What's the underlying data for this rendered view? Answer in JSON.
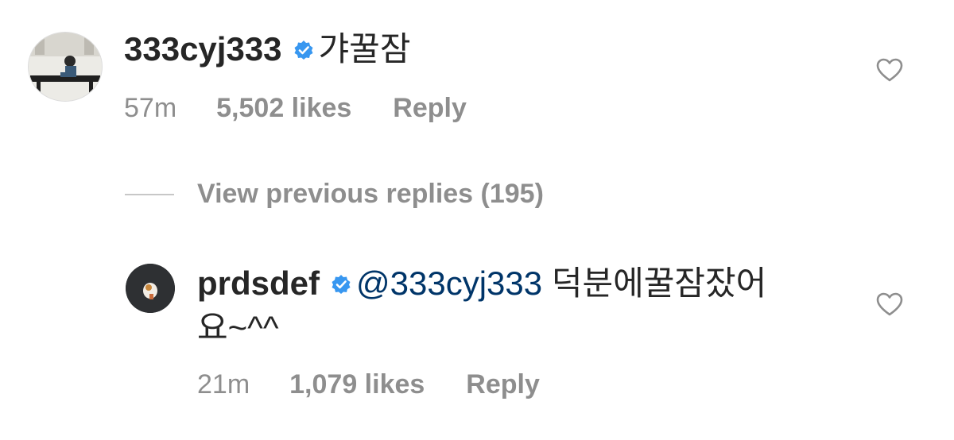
{
  "comment": {
    "username": "333cyj333",
    "text": "갸꿀잠",
    "time": "57m",
    "likes": "5,502 likes",
    "reply_label": "Reply"
  },
  "view_previous": "View previous replies (195)",
  "reply": {
    "username": "prdsdef",
    "mention": "@333cyj333",
    "text_line1": "덕분에꿀잠잤어",
    "text_line2": "요~^^",
    "time": "21m",
    "likes": "1,079 likes",
    "reply_label": "Reply"
  },
  "icons": {
    "verified": "verified-badge-icon",
    "like": "heart-outline-icon"
  },
  "colors": {
    "verified_blue": "#3897f0",
    "mention": "#003569",
    "meta_gray": "#8e8e8e"
  }
}
